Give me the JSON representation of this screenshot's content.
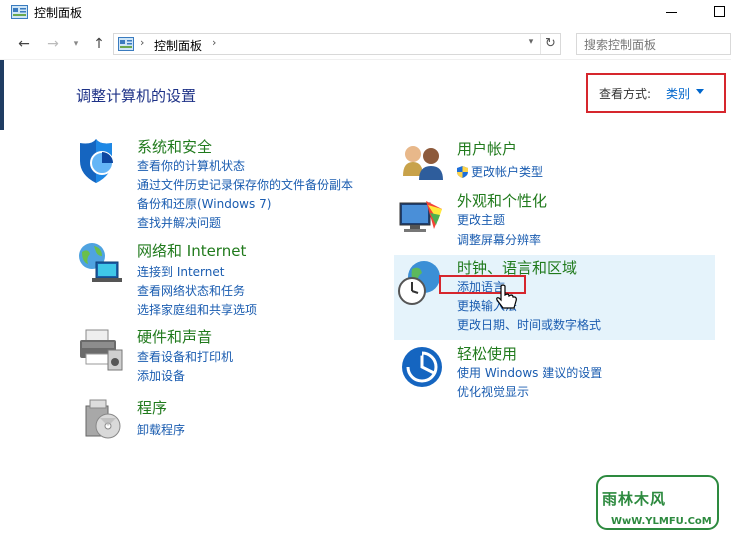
{
  "window": {
    "title": "控制面板"
  },
  "navigation": {
    "breadcrumb": "控制面板",
    "search_placeholder": "搜索控制面板"
  },
  "header": {
    "page_title": "调整计算机的设置",
    "view_by_label": "查看方式:",
    "view_by_value": "类别"
  },
  "categories": {
    "system_security": {
      "title": "系统和安全",
      "links": [
        "查看你的计算机状态",
        "通过文件历史记录保存你的文件备份副本",
        "备份和还原(Windows 7)",
        "查找并解决问题"
      ]
    },
    "network": {
      "title": "网络和 Internet",
      "links": [
        "连接到 Internet",
        "查看网络状态和任务",
        "选择家庭组和共享选项"
      ]
    },
    "hardware": {
      "title": "硬件和声音",
      "links": [
        "查看设备和打印机",
        "添加设备"
      ]
    },
    "programs": {
      "title": "程序",
      "links": [
        "卸载程序"
      ]
    },
    "user_accounts": {
      "title": "用户帐户",
      "links": [
        "更改帐户类型"
      ]
    },
    "appearance": {
      "title": "外观和个性化",
      "links": [
        "更改主题",
        "调整屏幕分辨率"
      ]
    },
    "clock_region": {
      "title": "时钟、语言和区域",
      "links": [
        "添加语言",
        "更换输入法",
        "更改日期、时间或数字格式"
      ]
    },
    "ease_of_access": {
      "title": "轻松使用",
      "links": [
        "使用 Windows 建议的设置",
        "优化视觉显示"
      ]
    }
  },
  "watermark": {
    "text": "雨林木风",
    "url": "WwW.YLMFU.CoM"
  },
  "colors": {
    "category_title": "#207a1c",
    "link": "#1a5cb0",
    "page_title": "#1e3287",
    "highlight_border": "#d6262d",
    "hover_background": "#e5f3fb"
  }
}
